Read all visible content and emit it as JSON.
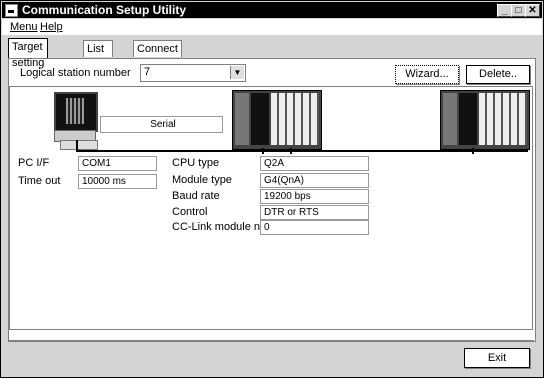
{
  "window": {
    "title": "Communication Setup Utility",
    "min": "_",
    "max": "□",
    "close": "✕"
  },
  "menu": {
    "items": [
      "Menu",
      "Help"
    ]
  },
  "tabs": [
    "Target setting",
    "List view",
    "Connect test"
  ],
  "logical_station": {
    "label": "Logical station number",
    "value": "7",
    "arrow": "▼"
  },
  "buttons": {
    "wizard": "Wizard...",
    "delete": "Delete..",
    "exit": "Exit"
  },
  "diagram": {
    "serial_label": "Serial"
  },
  "pc_fields": [
    {
      "label": "PC I/F",
      "value": "COM1"
    },
    {
      "label": "Time out",
      "value": "10000 ms"
    }
  ],
  "cpu_fields": [
    {
      "label": "CPU type",
      "value": "Q2A"
    },
    {
      "label": "Module type",
      "value": "G4(QnA)"
    },
    {
      "label": "Baud rate",
      "value": "19200 bps"
    },
    {
      "label": "Control",
      "value": "DTR or RTS"
    },
    {
      "label": "CC-Link module no",
      "value": "0"
    }
  ]
}
